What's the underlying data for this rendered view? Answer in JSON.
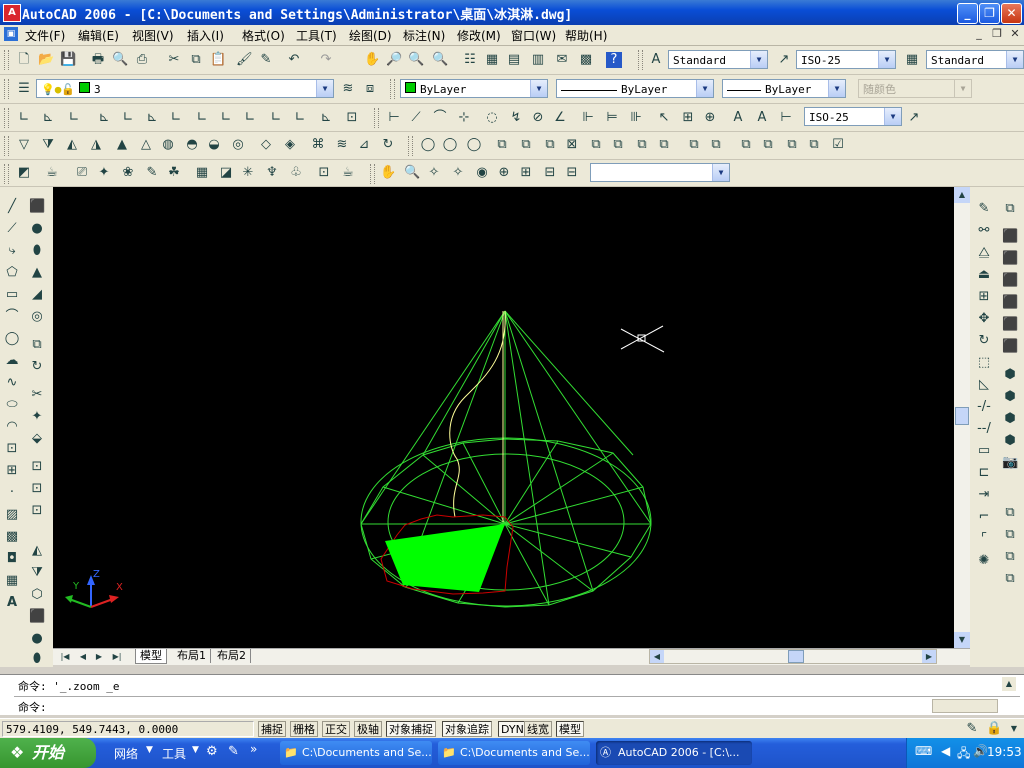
{
  "window": {
    "title": "AutoCAD 2006 - [C:\\Documents and Settings\\Administrator\\桌面\\冰淇淋.dwg]",
    "app_icon": "A"
  },
  "menu": [
    "文件(F)",
    "编辑(E)",
    "视图(V)",
    "插入(I)",
    "格式(O)",
    "工具(T)",
    "绘图(D)",
    "标注(N)",
    "修改(M)",
    "窗口(W)",
    "帮助(H)"
  ],
  "toolbar": {
    "text_style": "Standard",
    "dim_style": "ISO-25",
    "table_style": "Standard",
    "layer": "3",
    "color": "ByLayer",
    "linetype": "ByLayer",
    "lineweight": "ByLayer",
    "plot_style": "随颜色",
    "dim_style_2": "ISO-25",
    "named_view": ""
  },
  "tabs": [
    "模型",
    "布局1",
    "布局2"
  ],
  "command": {
    "history": "命令: '_.zoom _e",
    "prompt": "命令:"
  },
  "status": {
    "coords": "579.4109, 549.7443, 0.0000",
    "toggles": [
      {
        "label": "捕捉",
        "on": false
      },
      {
        "label": "栅格",
        "on": false
      },
      {
        "label": "正交",
        "on": false
      },
      {
        "label": "极轴",
        "on": false
      },
      {
        "label": "对象捕捉",
        "on": true
      },
      {
        "label": "对象追踪",
        "on": true
      },
      {
        "label": "DYN",
        "on": true
      },
      {
        "label": "线宽",
        "on": false
      },
      {
        "label": "模型",
        "on": true
      }
    ]
  },
  "taskbar": {
    "start": "开始",
    "quick": [
      "网络",
      "工具"
    ],
    "tasks": [
      {
        "label": "C:\\Documents and Se...",
        "active": false
      },
      {
        "label": "C:\\Documents and Se...",
        "active": false
      },
      {
        "label": "AutoCAD 2006 - [C:\\...",
        "active": true
      }
    ],
    "clock": "19:53"
  },
  "ucs": {
    "x": "X",
    "y": "Y",
    "z": "Z"
  },
  "colors": {
    "green": "#00ff00",
    "red": "#cc0000",
    "yellow": "#ffff66"
  }
}
